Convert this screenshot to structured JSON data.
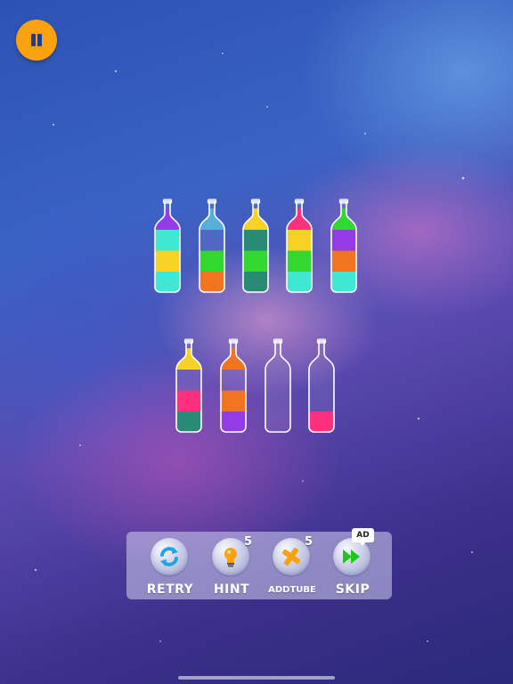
{
  "colors": {
    "purple": "#8a2be2",
    "teal": "#2ee6cf",
    "yellow": "#f7cf12",
    "green": "#21d41f",
    "orange": "#f06a0f",
    "dark_green": "#17806a",
    "pink": "#ff1f72",
    "cap_blue": "#4aa8d8",
    "toolbar_bg": "#d2d2f0",
    "pause_button": "#f7a20e"
  },
  "pause": {
    "icon": "pause-icon"
  },
  "bottles": [
    {
      "id": 1,
      "top_color": "purple",
      "layers": [
        "teal",
        "yellow",
        "teal"
      ]
    },
    {
      "id": 2,
      "top_color": "cap_blue",
      "layers": [
        "empty",
        "green",
        "orange"
      ]
    },
    {
      "id": 3,
      "top_color": "yellow",
      "layers": [
        "dark_green",
        "green",
        "dark_green"
      ]
    },
    {
      "id": 4,
      "top_color": "pink",
      "layers": [
        "yellow",
        "green",
        "teal"
      ]
    },
    {
      "id": 5,
      "top_color": "green",
      "layers": [
        "purple",
        "orange",
        "teal"
      ]
    },
    {
      "id": 6,
      "top_color": "yellow",
      "layers": [
        "empty",
        "pink",
        "dark_green"
      ]
    },
    {
      "id": 7,
      "top_color": "orange",
      "layers": [
        "empty",
        "orange",
        "purple"
      ]
    },
    {
      "id": 8,
      "top_color": "empty",
      "layers": [
        "empty",
        "empty",
        "empty"
      ]
    },
    {
      "id": 9,
      "top_color": "empty",
      "layers": [
        "empty",
        "empty",
        "pink"
      ]
    }
  ],
  "toolbar": {
    "retry": {
      "label": "RETRY",
      "icon": "refresh-icon"
    },
    "hint": {
      "label": "HINT",
      "icon": "lightbulb-icon",
      "count": "5"
    },
    "addtube": {
      "label": "ADDTUBE",
      "icon": "plus-icon",
      "count": "5"
    },
    "skip": {
      "label": "SKIP",
      "icon": "fast-forward-icon",
      "badge": "AD"
    }
  }
}
